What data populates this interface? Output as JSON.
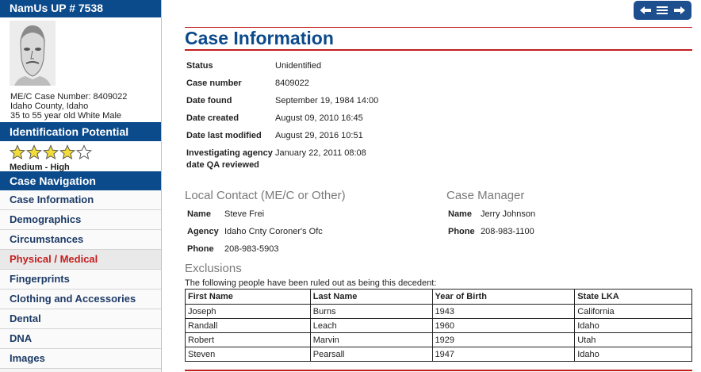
{
  "sidebar": {
    "header": "NamUs UP # 7538",
    "case_lines": [
      "ME/C Case Number: 8409022",
      "Idaho County, Idaho",
      "35 to 55 year old White Male"
    ],
    "id_potential_title": "Identification Potential",
    "id_potential": {
      "rating": 4,
      "max": 5,
      "label": "Medium - High"
    },
    "nav_title": "Case Navigation",
    "nav_items": [
      "Case Information",
      "Demographics",
      "Circumstances",
      "Physical / Medical",
      "Fingerprints",
      "Clothing and Accessories",
      "Dental",
      "DNA",
      "Images"
    ],
    "active_item": "Physical / Medical"
  },
  "main": {
    "title": "Case Information",
    "info": [
      {
        "label": "Status",
        "value": "Unidentified"
      },
      {
        "label": "Case number",
        "value": "8409022"
      },
      {
        "label": "Date found",
        "value": "September 19, 1984 14:00"
      },
      {
        "label": "Date created",
        "value": "August 09, 2010 16:45"
      },
      {
        "label": "Date last modified",
        "value": "August 29, 2016 10:51"
      },
      {
        "label": "Investigating agency",
        "value": "January 22, 2011 08:08"
      }
    ],
    "qa_label": "date QA reviewed",
    "local_contact": {
      "title": "Local Contact (ME/C or Other)",
      "name_label": "Name",
      "name": "Steve Frei",
      "agency_label": "Agency",
      "agency": "Idaho Cnty Coroner's Ofc",
      "phone_label": "Phone",
      "phone": "208-983-5903"
    },
    "case_manager": {
      "title": "Case Manager",
      "name_label": "Name",
      "name": "Jerry Johnson",
      "phone_label": "Phone",
      "phone": "208-983-1100"
    },
    "exclusions": {
      "title": "Exclusions",
      "note": "The following people have been ruled out as being this decedent:",
      "columns": [
        "First Name",
        "Last Name",
        "Year of Birth",
        "State LKA"
      ],
      "rows": [
        [
          "Joseph",
          "Burns",
          "1943",
          "California"
        ],
        [
          "Randall",
          "Leach",
          "1960",
          "Idaho"
        ],
        [
          "Robert",
          "Marvin",
          "1929",
          "Utah"
        ],
        [
          "Steven",
          "Pearsall",
          "1947",
          "Idaho"
        ]
      ]
    }
  },
  "colors": {
    "brand_blue": "#0b4a8b",
    "accent_red": "#c41e1e",
    "star_fill": "#f2dc3a"
  },
  "icons": {
    "nav_buttons": [
      "arrow-left-icon",
      "menu-icon",
      "arrow-right-icon"
    ]
  }
}
